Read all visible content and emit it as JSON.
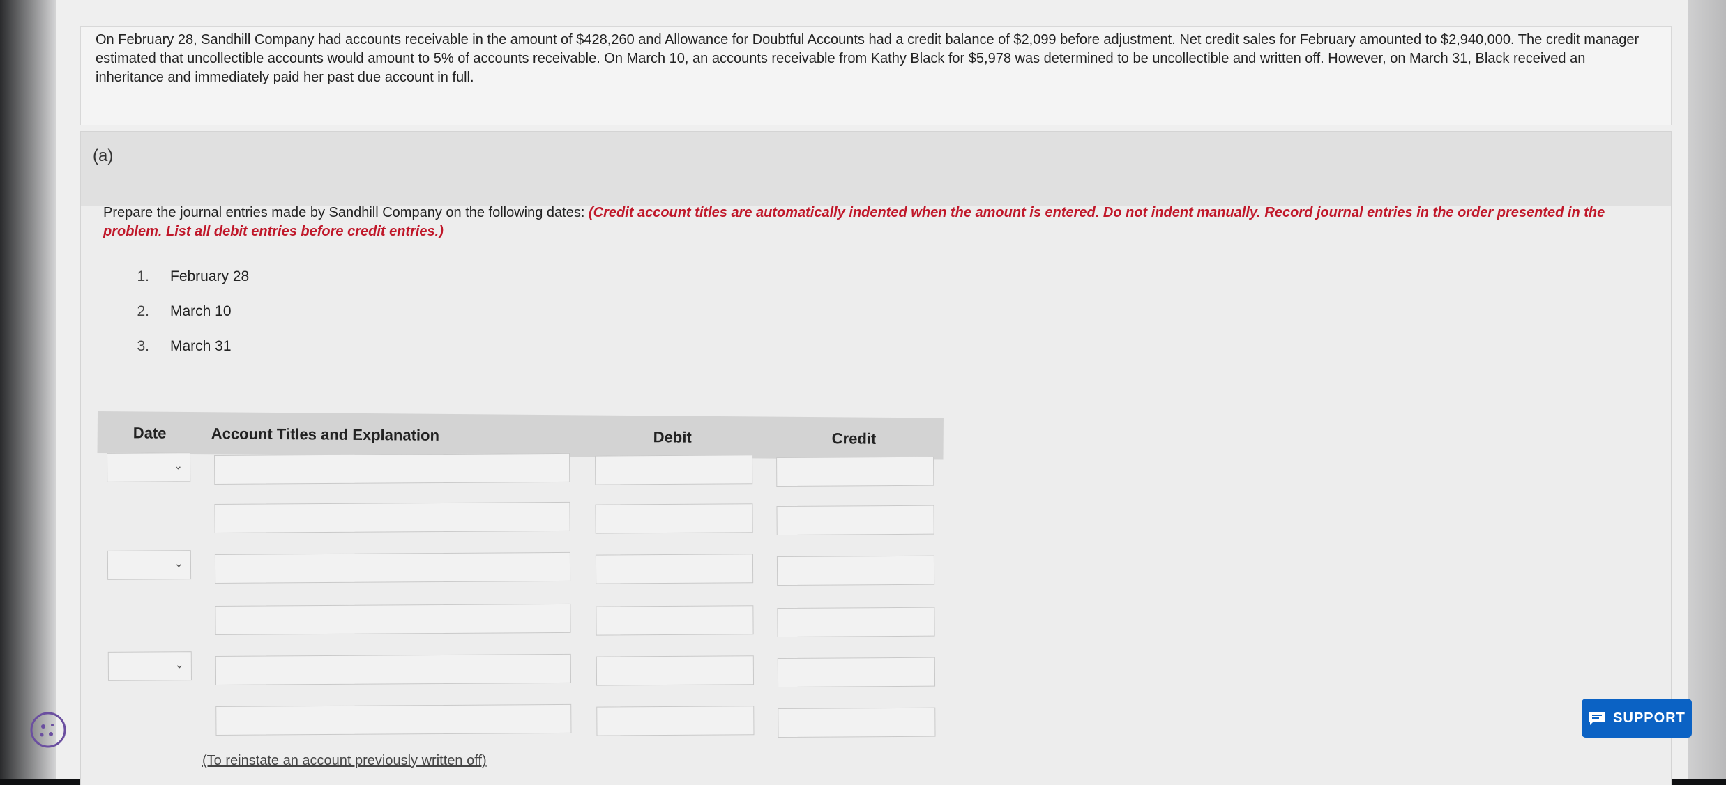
{
  "problem": {
    "text": "On February 28, Sandhill Company had accounts receivable in the amount of $428,260 and Allowance for Doubtful Accounts had a credit balance of $2,099 before adjustment. Net credit sales for February amounted to $2,940,000. The credit manager estimated that uncollectible accounts would amount to 5% of accounts receivable. On March 10, an accounts receivable from Kathy Black for $5,978 was determined to be uncollectible and written off. However, on March 31, Black received an inheritance and immediately paid her past due account in full."
  },
  "part": {
    "label": "(a)",
    "instruction_plain": "Prepare the journal entries made by Sandhill Company on the following dates: ",
    "instruction_red": "(Credit account titles are automatically indented when the amount is entered. Do not indent manually. Record journal entries in the order presented in the problem. List all debit entries before credit entries.)",
    "dates": [
      {
        "num": "1.",
        "label": "February 28"
      },
      {
        "num": "2.",
        "label": "March 10"
      },
      {
        "num": "3.",
        "label": "March 31"
      }
    ]
  },
  "journal": {
    "headers": {
      "date": "Date",
      "account": "Account Titles and Explanation",
      "debit": "Debit",
      "credit": "Credit"
    },
    "rows": [
      {
        "date": "",
        "account": "",
        "debit": "",
        "credit": ""
      },
      {
        "account": "",
        "debit": "",
        "credit": ""
      },
      {
        "date": "",
        "account": "",
        "debit": "",
        "credit": ""
      },
      {
        "account": "",
        "debit": "",
        "credit": ""
      },
      {
        "date": "",
        "account": "",
        "debit": "",
        "credit": ""
      },
      {
        "account": "",
        "debit": "",
        "credit": ""
      }
    ],
    "footnote": "(To reinstate an account previously written off)"
  },
  "support": {
    "label": "SUPPORT"
  },
  "colors": {
    "accent": "#0b62c4",
    "instruction_red": "#c0182a"
  }
}
